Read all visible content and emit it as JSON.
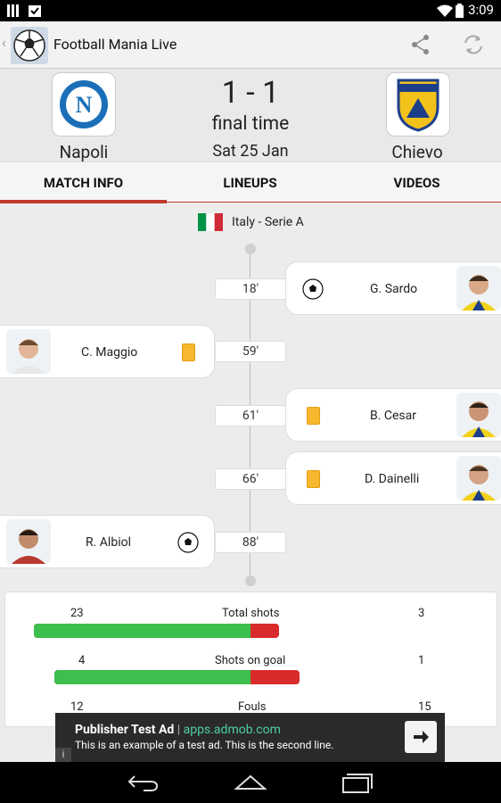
{
  "status_bar": {
    "time": "3:09"
  },
  "app": {
    "title": "Football Mania Live"
  },
  "match": {
    "home": {
      "name": "Napoli",
      "crest_letter": "N"
    },
    "away": {
      "name": "Chievo"
    },
    "score": "1 - 1",
    "status": "final time",
    "date": "Sat 25 Jan"
  },
  "tabs": [
    {
      "label": "MATCH INFO",
      "active": true
    },
    {
      "label": "LINEUPS",
      "active": false
    },
    {
      "label": "VIDEOS",
      "active": false
    }
  ],
  "competition": {
    "name": "Italy - Serie A",
    "flag_colors": [
      "#009246",
      "#ffffff",
      "#ce2b37"
    ]
  },
  "events": [
    {
      "minute": "18'",
      "side": "away",
      "player": "G. Sardo",
      "type": "goal"
    },
    {
      "minute": "59'",
      "side": "home",
      "player": "C. Maggio",
      "type": "yellow-card"
    },
    {
      "minute": "61'",
      "side": "away",
      "player": "B. Cesar",
      "type": "yellow-card"
    },
    {
      "minute": "66'",
      "side": "away",
      "player": "D. Dainelli",
      "type": "yellow-card"
    },
    {
      "minute": "88'",
      "side": "home",
      "player": "R. Albiol",
      "type": "goal"
    }
  ],
  "stats": [
    {
      "label": "Total shots",
      "home": "23",
      "away": "3",
      "home_share": 0.885
    },
    {
      "label": "Shots on goal",
      "home": "4",
      "away": "1",
      "home_share": 0.8
    },
    {
      "label": "Fouls",
      "home": "12",
      "away": "15"
    }
  ],
  "ad": {
    "title": "Publisher Test Ad",
    "domain": "apps.admob.com",
    "separator": " | ",
    "body": "This is an example of a test ad. This is the second line.",
    "info": "i"
  },
  "colors": {
    "accent": "#c0392b",
    "yellow_card": "#f5b82e",
    "bar_home": "#3cbf4d",
    "bar_away": "#d92b2b"
  }
}
